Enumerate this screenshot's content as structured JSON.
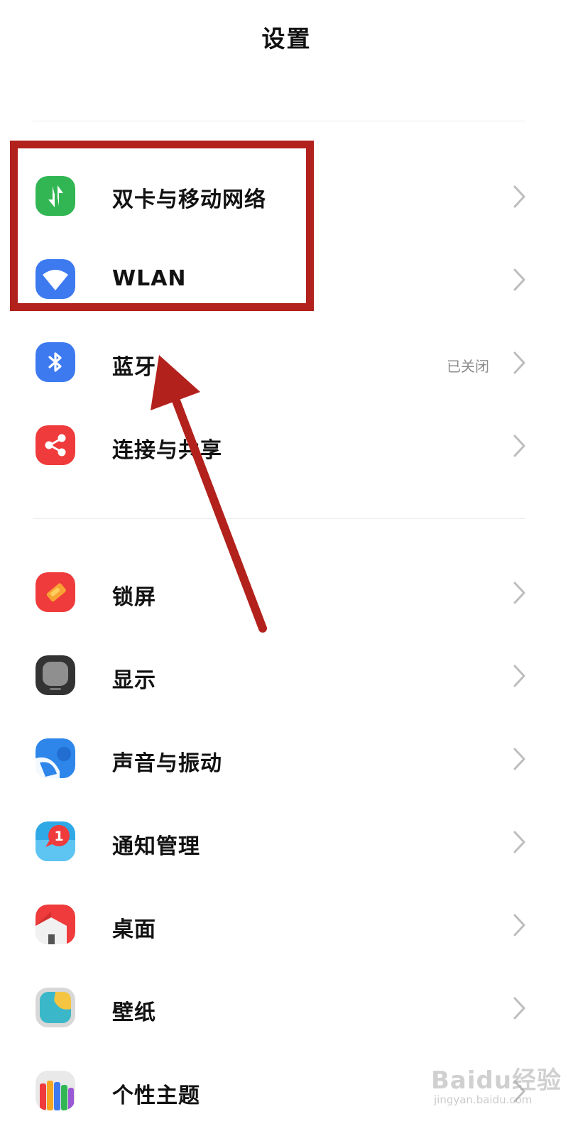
{
  "header": {
    "title": "设置"
  },
  "groups": [
    {
      "items": [
        {
          "label": "双卡与移动网络",
          "icon": "dual-sim-icon",
          "color": "#31b653"
        },
        {
          "label": "WLAN",
          "icon": "wifi-icon",
          "color": "#3d7af0"
        },
        {
          "label": "蓝牙",
          "icon": "bluetooth-icon",
          "color": "#3d7af0",
          "status": "已关闭"
        },
        {
          "label": "连接与共享",
          "icon": "share-icon",
          "color": "#ef3b3b"
        }
      ]
    },
    {
      "items": [
        {
          "label": "锁屏",
          "icon": "lock-screen-icon",
          "color": "#ef3b3b"
        },
        {
          "label": "显示",
          "icon": "display-icon",
          "color": "#3a3a3a"
        },
        {
          "label": "声音与振动",
          "icon": "sound-icon",
          "color": "#2f86ea"
        },
        {
          "label": "通知管理",
          "icon": "notification-icon",
          "color": "#2fa9e6"
        },
        {
          "label": "桌面",
          "icon": "home-screen-icon",
          "color": "#ef3b3b"
        },
        {
          "label": "壁纸",
          "icon": "wallpaper-icon",
          "color": "#3ab8c9"
        },
        {
          "label": "个性主题",
          "icon": "themes-icon",
          "color": "#e6e6e6"
        }
      ]
    }
  ],
  "watermark": {
    "brand": "Baidu经验",
    "url": "jingyan.baidu.com"
  },
  "colors": {
    "highlight": "#b3211c",
    "chevron": "#bdbdbd",
    "status": "#8c8c8c"
  }
}
